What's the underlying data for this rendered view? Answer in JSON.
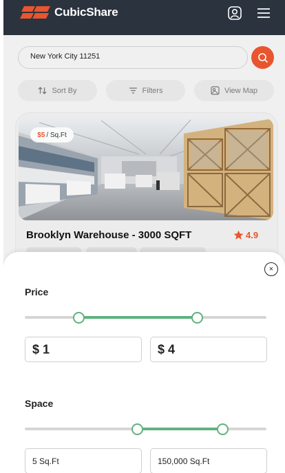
{
  "header": {
    "brand": "CubicShare",
    "brand_color": "#e8552e",
    "bar_color": "#2b333f",
    "profile_icon": "user-icon",
    "menu_icon": "hamburger-menu-icon"
  },
  "search": {
    "value": "New York City 11251",
    "button_icon": "search-icon"
  },
  "chips": [
    {
      "label": "Sort By",
      "icon": "sort-icon"
    },
    {
      "label": "Filters",
      "icon": "filter-icon"
    },
    {
      "label": "View Map",
      "icon": "map-icon"
    }
  ],
  "listing": {
    "price_value": "$5",
    "price_unit": "/ Sq.Ft",
    "title": "Brooklyn Warehouse - 3000 SQFT",
    "rating": "4.9",
    "rating_icon": "star-icon"
  },
  "filter_sheet": {
    "close_label": "×",
    "price": {
      "title": "Price",
      "min_value": "$ 1",
      "max_value": "$ 4",
      "range_low_fraction": 0.225,
      "range_high_fraction": 0.715
    },
    "space": {
      "title": "Space",
      "min_value": "5 Sq.Ft",
      "max_value": "150,000 Sq.Ft",
      "range_low_fraction": 0.465,
      "range_high_fraction": 0.82
    },
    "accent_color": "#5fb27e"
  }
}
